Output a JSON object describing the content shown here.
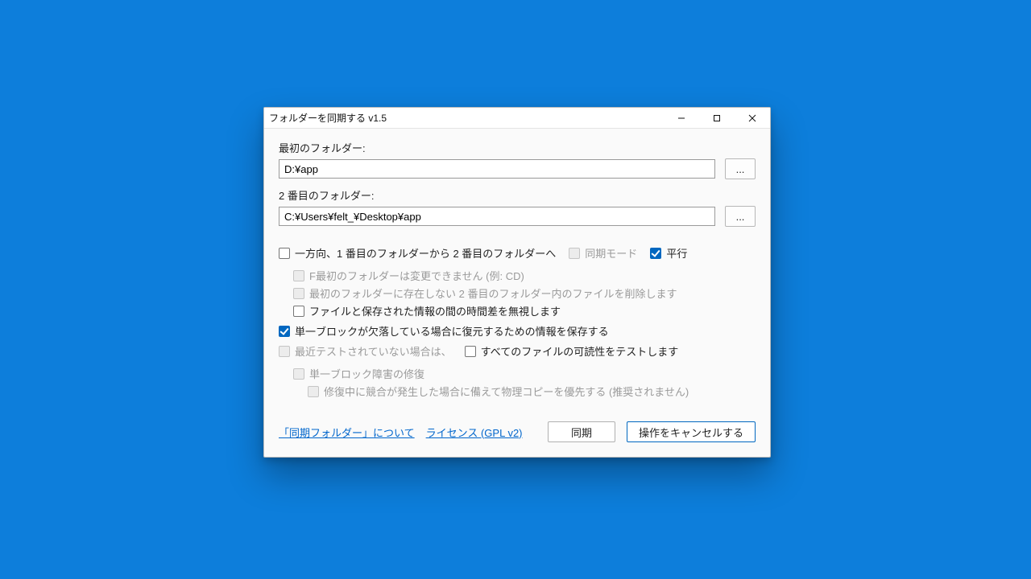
{
  "titlebar": {
    "title": "フォルダーを同期する v1.5"
  },
  "folder1": {
    "label": "最初のフォルダー:",
    "value": "D:¥app",
    "browse": "..."
  },
  "folder2": {
    "label": "2 番目のフォルダー:",
    "value": "C:¥Users¥felt_¥Desktop¥app",
    "browse": "..."
  },
  "opts": {
    "one_way": "一方向、1 番目のフォルダーから 2 番目のフォルダーへ",
    "sync_mode": "同期モード",
    "parallel": "平行",
    "f_first_readonly": "F最初のフォルダーは変更できません (例: CD)",
    "delete_missing": "最初のフォルダーに存在しない 2 番目のフォルダー内のファイルを削除します",
    "ignore_time_diff": "ファイルと保存された情報の間の時間差を無視します",
    "store_restore_info": "単一ブロックが欠落している場合に復元するための情報を保存する",
    "if_not_tested": "最近テストされていない場合は、",
    "test_all_readability": "すべてのファイルの可読性をテストします",
    "repair_block": "単一ブロック障害の修復",
    "prefer_physical_copy": "修復中に競合が発生した場合に備えて物理コピーを優先する (推奨されません)"
  },
  "footer": {
    "about": "「同期フォルダー」について",
    "license": "ライセンス (GPL v2)",
    "sync": "同期",
    "cancel": "操作をキャンセルする"
  }
}
